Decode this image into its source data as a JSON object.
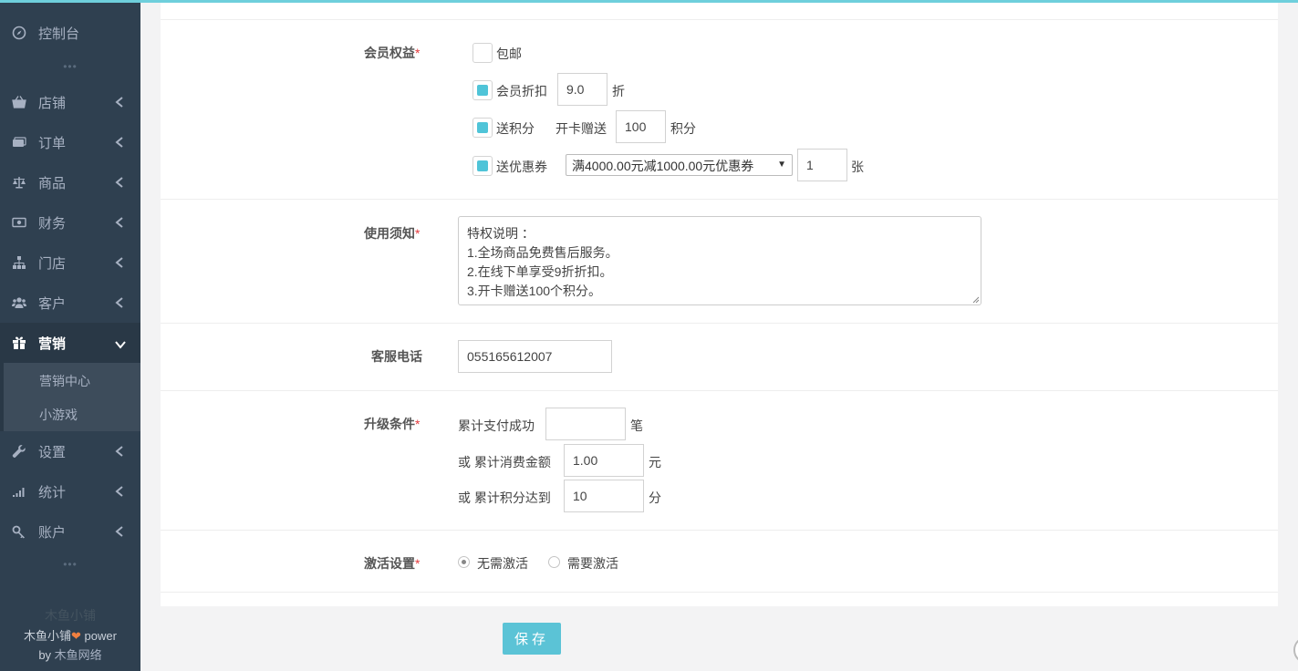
{
  "sidebar": {
    "dashboard": "控制台",
    "items": [
      {
        "label": "店铺",
        "icon": "basket-icon"
      },
      {
        "label": "订单",
        "icon": "money-icon"
      },
      {
        "label": "商品",
        "icon": "balance-scale-icon"
      },
      {
        "label": "财务",
        "icon": "banknote-icon"
      },
      {
        "label": "门店",
        "icon": "sitemap-icon"
      },
      {
        "label": "客户",
        "icon": "users-icon"
      },
      {
        "label": "营销",
        "icon": "gift-icon",
        "active": true
      },
      {
        "label": "设置",
        "icon": "wrench-icon"
      },
      {
        "label": "统计",
        "icon": "signal-icon"
      },
      {
        "label": "账户",
        "icon": "key-icon"
      }
    ],
    "submenu": [
      "营销中心",
      "小游戏"
    ],
    "dots": "•••",
    "brand_ghost": "木鱼小铺",
    "brand_name": "木鱼小铺",
    "brand_heart": "❤",
    "brand_power": " power",
    "by_text": "by ",
    "by_name": "木鱼网络"
  },
  "form": {
    "benefits": {
      "label": "会员权益",
      "free_shipping": {
        "label": "包邮",
        "checked": false
      },
      "discount": {
        "label": "会员折扣",
        "value": "9.0",
        "unit": "折",
        "checked": true
      },
      "points": {
        "label": "送积分",
        "prefix": "开卡赠送",
        "value": "100",
        "unit": "积分",
        "checked": true
      },
      "coupon": {
        "label": "送优惠券",
        "selected": "满4000.00元减1000.00元优惠券",
        "count": "1",
        "unit": "张",
        "checked": true
      }
    },
    "notice": {
      "label": "使用须知",
      "text": "特权说明 ：\n1.全场商品免费售后服务。\n2.在线下单享受9折折扣。\n3.开卡赠送100个积分。"
    },
    "phone": {
      "label": "客服电话",
      "value": "055165612007"
    },
    "upgrade": {
      "label": "升级条件",
      "pay_label": "累计支付成功",
      "pay_value": "",
      "pay_unit": "笔",
      "amount_label": "或 累计消费金额",
      "amount_value": "1.00",
      "amount_unit": "元",
      "points_label": "或 累计积分达到",
      "points_value": "10",
      "points_unit": "分"
    },
    "activation": {
      "label": "激活设置",
      "options": [
        "无需激活",
        "需要激活"
      ],
      "selected": 0
    },
    "required_mark": "*",
    "save_label": "保存"
  },
  "colors": {
    "accent": "#5bc3d6",
    "sidebar_bg": "#2f4050",
    "required": "#e4393c"
  }
}
